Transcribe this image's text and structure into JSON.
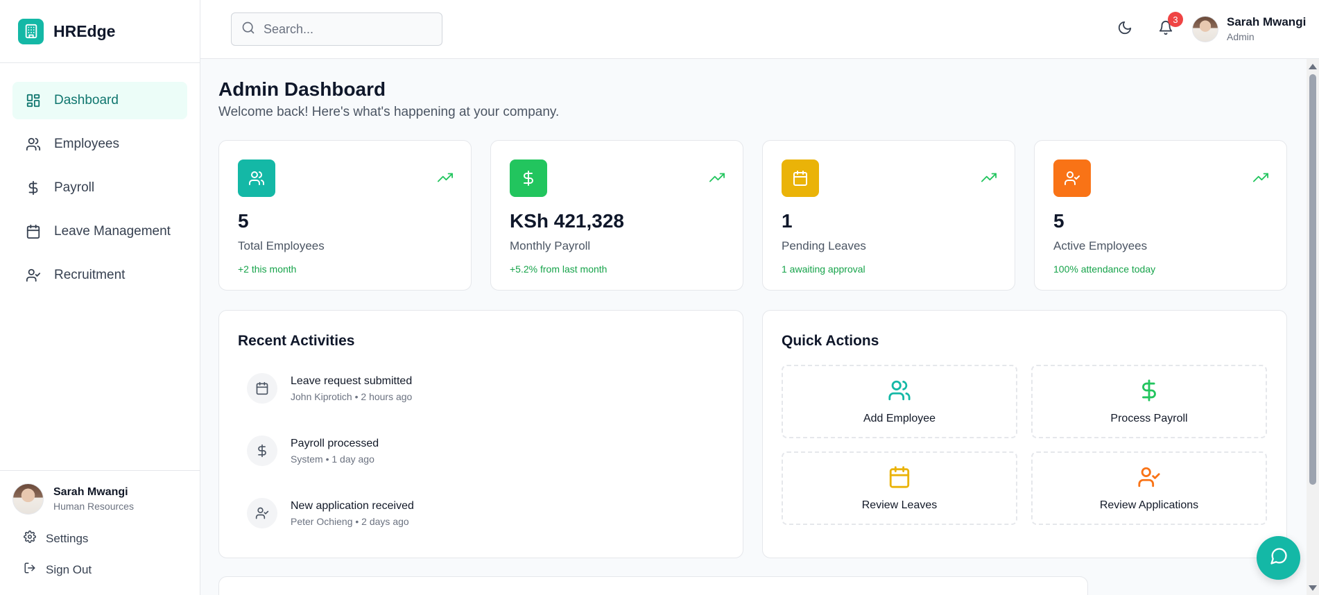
{
  "brand": {
    "name": "HREdge"
  },
  "sidebar": {
    "items": [
      {
        "label": "Dashboard",
        "icon": "layout-dashboard-icon",
        "active": true
      },
      {
        "label": "Employees",
        "icon": "users-icon"
      },
      {
        "label": "Payroll",
        "icon": "dollar-sign-icon"
      },
      {
        "label": "Leave Management",
        "icon": "calendar-icon"
      },
      {
        "label": "Recruitment",
        "icon": "user-check-icon"
      }
    ],
    "user": {
      "name": "Sarah Mwangi",
      "role": "Human Resources"
    },
    "settings_label": "Settings",
    "signout_label": "Sign Out"
  },
  "topbar": {
    "search_placeholder": "Search...",
    "notification_count": "3",
    "user": {
      "name": "Sarah Mwangi",
      "role": "Admin"
    }
  },
  "main": {
    "title": "Admin Dashboard",
    "subtitle": "Welcome back! Here's what's happening at your company.",
    "stats": [
      {
        "value": "5",
        "label": "Total Employees",
        "note": "+2 this month",
        "color": "#14b8a6",
        "icon": "users-icon"
      },
      {
        "value": "KSh 421,328",
        "label": "Monthly Payroll",
        "note": "+5.2% from last month",
        "color": "#22c55e",
        "icon": "dollar-sign-icon"
      },
      {
        "value": "1",
        "label": "Pending Leaves",
        "note": "1 awaiting approval",
        "color": "#eab308",
        "icon": "calendar-icon"
      },
      {
        "value": "5",
        "label": "Active Employees",
        "note": "100% attendance today",
        "color": "#f97316",
        "icon": "user-check-icon"
      }
    ],
    "activities": {
      "title": "Recent Activities",
      "items": [
        {
          "title": "Leave request submitted",
          "meta": "John Kiprotich • 2 hours ago",
          "icon": "calendar-icon"
        },
        {
          "title": "Payroll processed",
          "meta": "System • 1 day ago",
          "icon": "dollar-sign-icon"
        },
        {
          "title": "New application received",
          "meta": "Peter Ochieng • 2 days ago",
          "icon": "user-check-icon"
        }
      ]
    },
    "quick_actions": {
      "title": "Quick Actions",
      "items": [
        {
          "label": "Add Employee",
          "color": "#14b8a6",
          "icon": "users-icon"
        },
        {
          "label": "Process Payroll",
          "color": "#22c55e",
          "icon": "dollar-sign-icon"
        },
        {
          "label": "Review Leaves",
          "color": "#eab308",
          "icon": "calendar-icon"
        },
        {
          "label": "Review Applications",
          "color": "#f97316",
          "icon": "user-check-icon"
        }
      ]
    }
  },
  "colors": {
    "accent": "#14b8a6",
    "success": "#16a34a",
    "badge": "#ef4444"
  }
}
